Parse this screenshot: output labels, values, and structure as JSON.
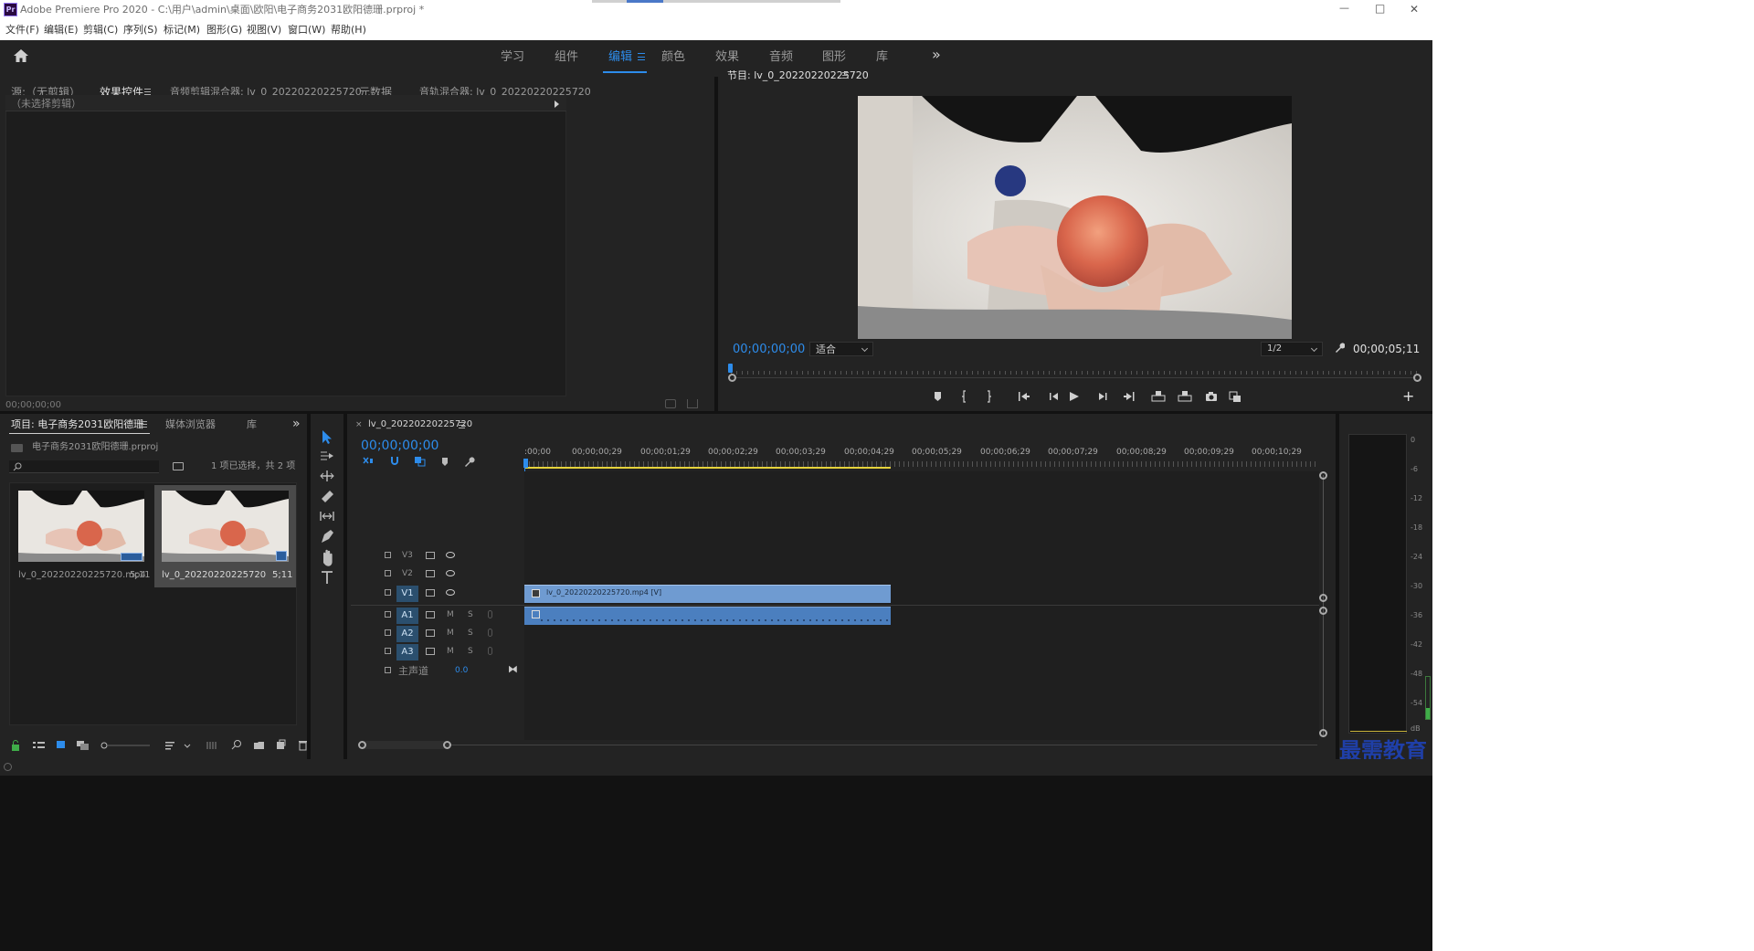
{
  "app": {
    "title": "Adobe Premiere Pro 2020 - C:\\用户\\admin\\桌面\\欧阳\\电子商务2031欧阳德珊.prproj *",
    "logo_text": "Pr"
  },
  "window_controls": {
    "minimize": "—",
    "maximize": "□",
    "close": "✕"
  },
  "menu": [
    "文件(F)",
    "编辑(E)",
    "剪辑(C)",
    "序列(S)",
    "标记(M)",
    "图形(G)",
    "视图(V)",
    "窗口(W)",
    "帮助(H)"
  ],
  "workspaces": [
    "学习",
    "组件",
    "编辑",
    "颜色",
    "效果",
    "音频",
    "图形",
    "库"
  ],
  "workspace_active": "编辑",
  "workspace_more": "»",
  "source_panel": {
    "tabs": [
      "源:（无剪辑）",
      "效果控件",
      "音频剪辑混合器: lv_0_20220220225720",
      "元数据",
      "音轨混合器: lv_0_20220220225720"
    ],
    "active_tab": "效果控件",
    "no_clip_text": "（未选择剪辑）",
    "timecode": "00;00;00;00"
  },
  "program_monitor": {
    "title": "节目: lv_0_20220220225720",
    "timecode": "00;00;00;00",
    "fit_label": "适合",
    "resolution": "1/2",
    "duration": "00;00;05;11"
  },
  "project_panel": {
    "tabs": [
      "项目: 电子商务2031欧阳德珊",
      "媒体浏览器",
      "库"
    ],
    "project_file": "电子商务2031欧阳德珊.prproj",
    "search_placeholder": "",
    "selection_info": "1 项已选择，共 2 项",
    "items": [
      {
        "name": "lv_0_20220220225720.mp4",
        "duration": "5;11"
      },
      {
        "name": "lv_0_20220220225720",
        "duration": "5;11"
      }
    ]
  },
  "timeline": {
    "sequence_tab": "lv_0_20220220225720",
    "timecode": "00;00;00;00",
    "ruler": [
      ":00;00",
      "00;00;00;29",
      "00;00;01;29",
      "00;00;02;29",
      "00;00;03;29",
      "00;00;04;29",
      "00;00;05;29",
      "00;00;06;29",
      "00;00;07;29",
      "00;00;08;29",
      "00;00;09;29",
      "00;00;10;29"
    ],
    "video_tracks": [
      "V3",
      "V2",
      "V1"
    ],
    "audio_tracks": [
      "A1",
      "A2",
      "A3"
    ],
    "mute_label": "M",
    "solo_label": "S",
    "master_label": "主声道",
    "master_value": "0.0",
    "clip_label": "lv_0_20220220225720.mp4 [V]"
  },
  "meter": {
    "scale": [
      "0",
      "-6",
      "-12",
      "-18",
      "-24",
      "-30",
      "-36",
      "-42",
      "-48",
      "-54",
      "dB"
    ]
  },
  "watermark": "最需教育",
  "colors": {
    "accent": "#2d8ceb",
    "clip_video": "#6f9bd1",
    "clip_audio": "#4b7fbf",
    "panel": "#1d1d1d",
    "chrome": "#232323"
  }
}
